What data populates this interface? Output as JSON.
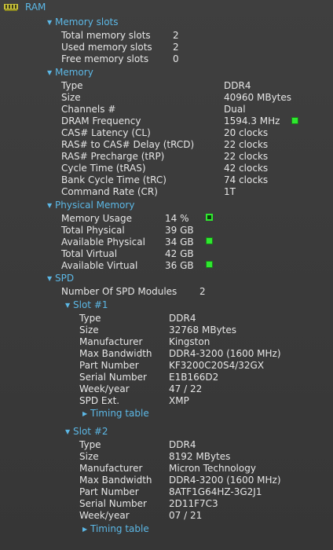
{
  "root": {
    "title": "RAM",
    "icon": "memory-module-icon"
  },
  "memory_slots": {
    "header": "Memory slots",
    "rows": [
      {
        "label": "Total memory slots",
        "value": "2"
      },
      {
        "label": "Used memory slots",
        "value": "2"
      },
      {
        "label": "Free memory slots",
        "value": "0"
      }
    ]
  },
  "memory": {
    "header": "Memory",
    "rows": [
      {
        "label": "Type",
        "value": "DDR4"
      },
      {
        "label": "Size",
        "value": "40960 MBytes"
      },
      {
        "label": "Channels #",
        "value": "Dual"
      },
      {
        "label": "DRAM Frequency",
        "value": "1594.3 MHz"
      },
      {
        "label": "CAS# Latency (CL)",
        "value": "20 clocks"
      },
      {
        "label": "RAS# to CAS# Delay (tRCD)",
        "value": "22 clocks"
      },
      {
        "label": "RAS# Precharge (tRP)",
        "value": "22 clocks"
      },
      {
        "label": "Cycle Time (tRAS)",
        "value": "42 clocks"
      },
      {
        "label": "Bank Cycle Time (tRC)",
        "value": "74 clocks"
      },
      {
        "label": "Command Rate (CR)",
        "value": "1T"
      }
    ]
  },
  "physical_memory": {
    "header": "Physical Memory",
    "rows": [
      {
        "label": "Memory Usage",
        "value": "14 %"
      },
      {
        "label": "Total Physical",
        "value": "39 GB"
      },
      {
        "label": "Available Physical",
        "value": "34 GB"
      },
      {
        "label": "Total Virtual",
        "value": "42 GB"
      },
      {
        "label": "Available Virtual",
        "value": "36 GB"
      }
    ]
  },
  "spd": {
    "header": "SPD",
    "modules_label": "Number Of SPD Modules",
    "modules_value": "2",
    "slots": [
      {
        "header": "Slot #1",
        "rows": [
          {
            "label": "Type",
            "value": "DDR4"
          },
          {
            "label": "Size",
            "value": "32768 MBytes"
          },
          {
            "label": "Manufacturer",
            "value": "Kingston"
          },
          {
            "label": "Max Bandwidth",
            "value": "DDR4-3200 (1600 MHz)"
          },
          {
            "label": "Part Number",
            "value": "KF3200C20S4/32GX"
          },
          {
            "label": "Serial Number",
            "value": "E1B166D2"
          },
          {
            "label": "Week/year",
            "value": "47 / 22"
          },
          {
            "label": "SPD Ext.",
            "value": "XMP"
          }
        ],
        "timing_link": "Timing table"
      },
      {
        "header": "Slot #2",
        "rows": [
          {
            "label": "Type",
            "value": "DDR4"
          },
          {
            "label": "Size",
            "value": "8192 MBytes"
          },
          {
            "label": "Manufacturer",
            "value": "Micron Technology"
          },
          {
            "label": "Max Bandwidth",
            "value": "DDR4-3200 (1600 MHz)"
          },
          {
            "label": "Part Number",
            "value": "8ATF1G64HZ-3G2J1"
          },
          {
            "label": "Serial Number",
            "value": "2D11F7C3"
          },
          {
            "label": "Week/year",
            "value": "07 / 21"
          }
        ],
        "timing_link": "Timing table"
      }
    ]
  },
  "colors": {
    "section_text": "#5cb8e6",
    "body_text": "#e6e6e6",
    "background": "#3b3b3b",
    "indicator_on": "#2fe82f"
  }
}
